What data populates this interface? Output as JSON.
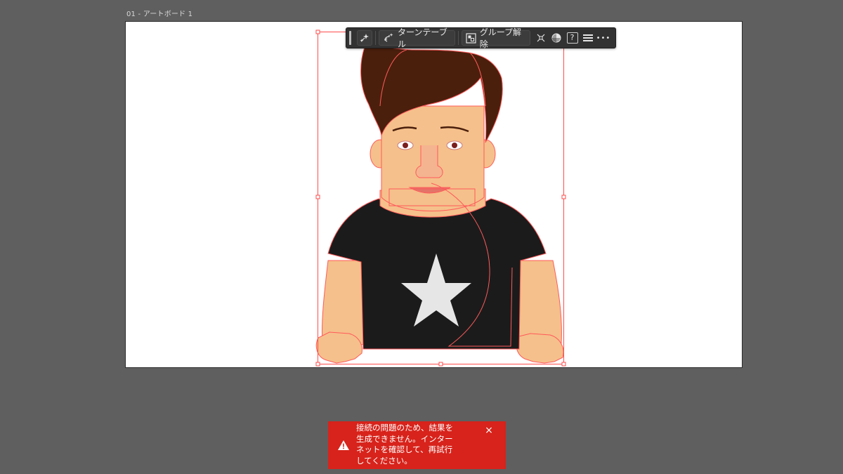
{
  "artboard": {
    "label": "01 - アートボード 1"
  },
  "taskbar": {
    "turntable_label": "ターンテーブル",
    "ungroup_label": "グループ解除",
    "help_label": "?",
    "more_label": "•••"
  },
  "toast": {
    "message": "接続の問題のため、結果を\n生成できません。インター\nネットを確認して、再試行\nしてください。",
    "close_label": "×"
  },
  "colors": {
    "canvas_bg": "#5f5f5f",
    "selection": "#ff4b4b",
    "toast_bg": "#d7231b",
    "skin": "#f5c08b",
    "hair": "#4a1f0c",
    "shirt": "#1b1b1b",
    "star": "#e6e6e6"
  }
}
